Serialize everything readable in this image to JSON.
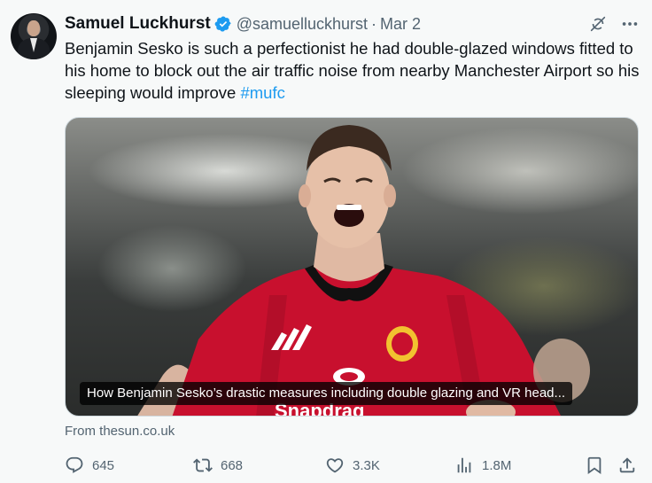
{
  "author": {
    "display_name": "Samuel Luckhurst",
    "handle": "@samuelluckhurst",
    "separator": "·",
    "date": "Mar 2"
  },
  "tweet": {
    "text": "Benjamin Sesko is such a perfectionist he had double-glazed windows fitted to his home to block out the air traffic noise from nearby Manchester Airport so his sleeping would improve ",
    "hashtag": "#mufc"
  },
  "card": {
    "caption": "How Benjamin Sesko’s drastic measures including double glazing and VR head...",
    "source": "From thesun.co.uk",
    "jersey_sponsor": "Snapdrag"
  },
  "metrics": {
    "replies": "645",
    "reposts": "668",
    "likes": "3.3K",
    "views": "1.8M"
  },
  "colors": {
    "accent": "#1d9bf0",
    "muted": "#536471",
    "text": "#0f1419",
    "background": "#f7f9f9"
  },
  "icons": [
    "verified-badge-icon",
    "grok-icon",
    "more-icon",
    "reply-icon",
    "repost-icon",
    "like-icon",
    "views-icon",
    "bookmark-icon",
    "share-icon"
  ]
}
